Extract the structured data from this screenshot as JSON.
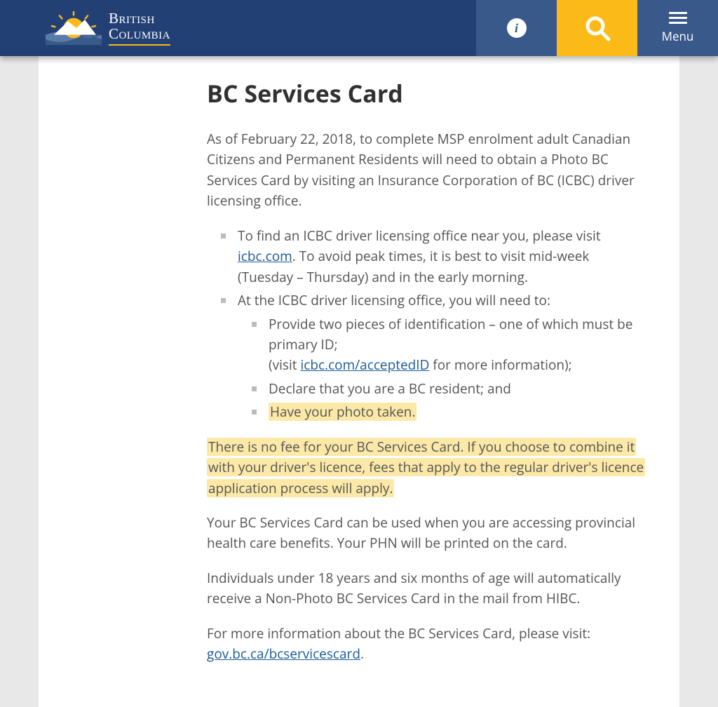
{
  "header": {
    "brand_line1": "British",
    "brand_line2": "Columbia",
    "menu_label": "Menu"
  },
  "page": {
    "title": "BC Services Card"
  },
  "intro": "As of February 22, 2018, to complete MSP enrolment adult Canadian Citizens and Permanent Residents will need to obtain a Photo BC Services Card by visiting an Insurance Corporation of BC (ICBC) driver licensing office.",
  "list1": {
    "item1_part1": "To find an ICBC driver licensing office near you, please visit ",
    "item1_link": "icbc.com",
    "item1_part2": ". To avoid peak times, it is best to visit mid-week (Tuesday – Thursday) and in the early morning.",
    "item2": "At the ICBC driver licensing office, you will need to:",
    "sub1_part1": "Provide two pieces of identification – one of which must be primary ID;",
    "sub1_part2": "(visit ",
    "sub1_link": "icbc.com/acceptedID",
    "sub1_part3": " for more information);",
    "sub2": "Declare that you are a BC resident; and",
    "sub3": "Have your photo taken."
  },
  "fee_para": "There is no fee for your BC Services Card. If you choose to combine it with your driver's licence, fees that apply to the regular driver's licence application process will apply.",
  "use_para": "Your BC Services Card can be used when you are accessing provincial health care benefits. Your PHN will be printed on the card.",
  "under18_para": "Individuals under 18 years and six months of age will automatically receive a Non-Photo BC Services Card in the mail from HIBC.",
  "moreinfo": {
    "part1": "For more information about the BC Services Card, please visit: ",
    "link": "gov.bc.ca/bcservicescard",
    "part2": "."
  }
}
